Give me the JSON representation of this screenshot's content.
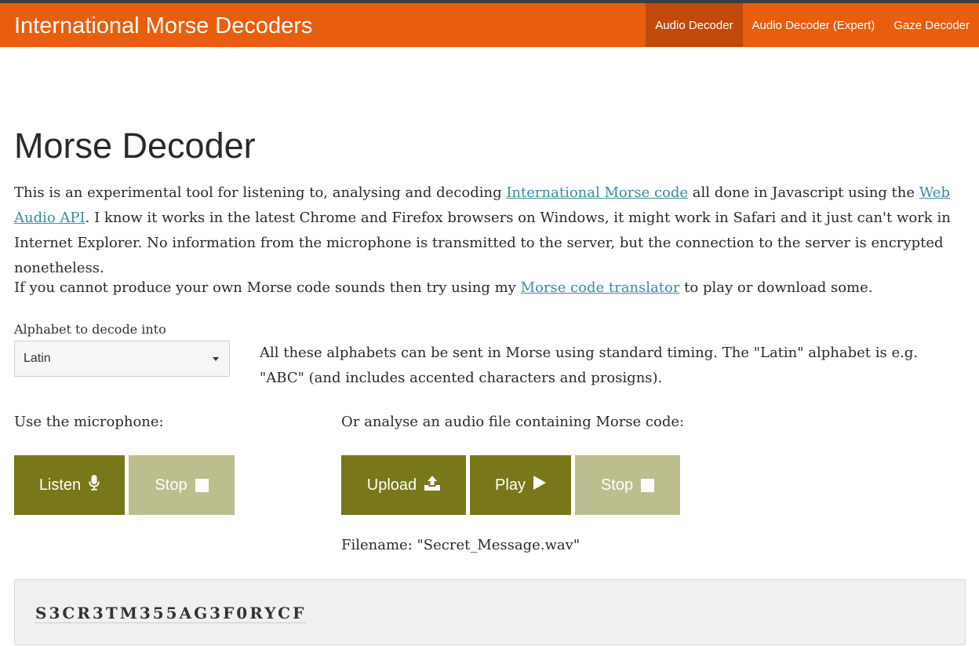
{
  "brand": "International Morse Decoders",
  "nav": [
    {
      "label": "Audio Decoder",
      "active": true
    },
    {
      "label": "Audio Decoder (Expert)",
      "active": false
    },
    {
      "label": "Gaze Decoder",
      "active": false
    }
  ],
  "page_title": "Morse Decoder",
  "intro": {
    "t1": "This is an experimental tool for listening to, analysing and decoding ",
    "link1": "International Morse code",
    "t2": " all done in Javascript using the ",
    "link2": "Web Audio API",
    "t3": ". I know it works in the latest Chrome and Firefox browsers on Windows, it might work in Safari and it just can't work in Internet Explorer. No information from the microphone is transmitted to the server, but the connection to the server is encrypted nonetheless."
  },
  "translator_para": {
    "t1": "If you cannot produce your own Morse code sounds then try using my ",
    "link": "Morse code translator",
    "t2": " to play or download some."
  },
  "alphabet": {
    "label": "Alphabet to decode into",
    "selected": "Latin",
    "note": "All these alphabets can be sent in Morse using standard timing. The \"Latin\" alphabet is e.g. \"ABC\" (and includes accented characters and prosigns)."
  },
  "microphone": {
    "label": "Use the microphone:",
    "listen": "Listen",
    "stop": "Stop"
  },
  "file": {
    "label": "Or analyse an audio file containing Morse code:",
    "upload": "Upload",
    "play": "Play",
    "stop": "Stop",
    "filename_prefix": "Filename: ",
    "filename": "\"Secret_Message.wav\""
  },
  "output": "S3CR3TM355AG3F0RYCF",
  "icons": {
    "listen": "microphone-icon",
    "stop": "stop-square-icon",
    "upload": "upload-icon",
    "play": "play-icon"
  },
  "colors": {
    "navbar": "#e85e0e",
    "nav_active": "#c0490b",
    "button_primary": "#78781a",
    "button_disabled": "#bcbe8d",
    "link": "#3e8aa0"
  }
}
